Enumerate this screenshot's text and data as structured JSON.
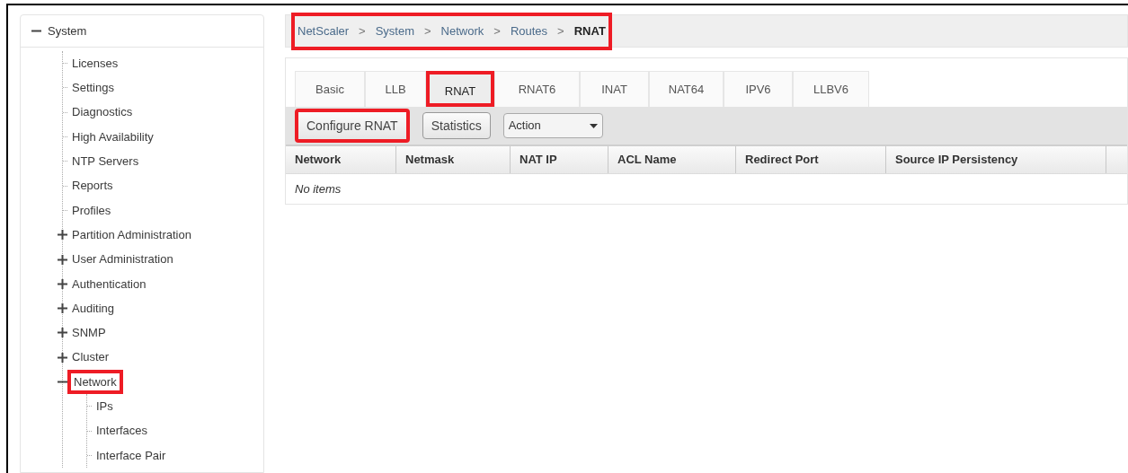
{
  "sidebar": {
    "tree": [
      {
        "label": "System",
        "expanded": true,
        "highlighted": false,
        "children": [
          {
            "label": "Licenses",
            "highlighted": false
          },
          {
            "label": "Settings",
            "highlighted": false
          },
          {
            "label": "Diagnostics",
            "highlighted": false
          },
          {
            "label": "High Availability",
            "highlighted": false
          },
          {
            "label": "NTP Servers",
            "highlighted": false
          },
          {
            "label": "Reports",
            "highlighted": false
          },
          {
            "label": "Profiles",
            "highlighted": false
          },
          {
            "label": "Partition Administration",
            "expanded": false,
            "highlighted": false
          },
          {
            "label": "User Administration",
            "expanded": false,
            "highlighted": false
          },
          {
            "label": "Authentication",
            "expanded": false,
            "highlighted": false
          },
          {
            "label": "Auditing",
            "expanded": false,
            "highlighted": false
          },
          {
            "label": "SNMP",
            "expanded": false,
            "highlighted": false
          },
          {
            "label": "Cluster",
            "expanded": false,
            "highlighted": false
          },
          {
            "label": "Network",
            "expanded": true,
            "highlighted": true,
            "children": [
              {
                "label": "IPs",
                "highlighted": false
              },
              {
                "label": "Interfaces",
                "highlighted": false
              },
              {
                "label": "Interface Pair",
                "highlighted": false
              }
            ]
          }
        ]
      }
    ]
  },
  "breadcrumb": {
    "highlighted": true,
    "items": [
      {
        "label": "NetScaler",
        "current": false
      },
      {
        "label": "System",
        "current": false
      },
      {
        "label": "Network",
        "current": false
      },
      {
        "label": "Routes",
        "current": false
      },
      {
        "label": "RNAT",
        "current": true
      }
    ],
    "separator": ">"
  },
  "tabs": [
    {
      "label": "Basic",
      "selected": false,
      "highlighted": false
    },
    {
      "label": "LLB",
      "selected": false,
      "highlighted": false
    },
    {
      "label": "RNAT",
      "selected": true,
      "highlighted": true
    },
    {
      "label": "RNAT6",
      "selected": false,
      "highlighted": false
    },
    {
      "label": "INAT",
      "selected": false,
      "highlighted": false
    },
    {
      "label": "NAT64",
      "selected": false,
      "highlighted": false
    },
    {
      "label": "IPV6",
      "selected": false,
      "highlighted": false
    },
    {
      "label": "LLBV6",
      "selected": false,
      "highlighted": false
    }
  ],
  "toolbar": [
    {
      "kind": "button",
      "label": "Configure RNAT",
      "highlighted": true
    },
    {
      "kind": "button",
      "label": "Statistics",
      "highlighted": false
    },
    {
      "kind": "dropdown",
      "label": "Action",
      "highlighted": false
    }
  ],
  "table": {
    "columns": [
      "Network",
      "Netmask",
      "NAT IP",
      "ACL Name",
      "Redirect Port",
      "Source IP Persistency"
    ],
    "empty_message": "No items"
  }
}
